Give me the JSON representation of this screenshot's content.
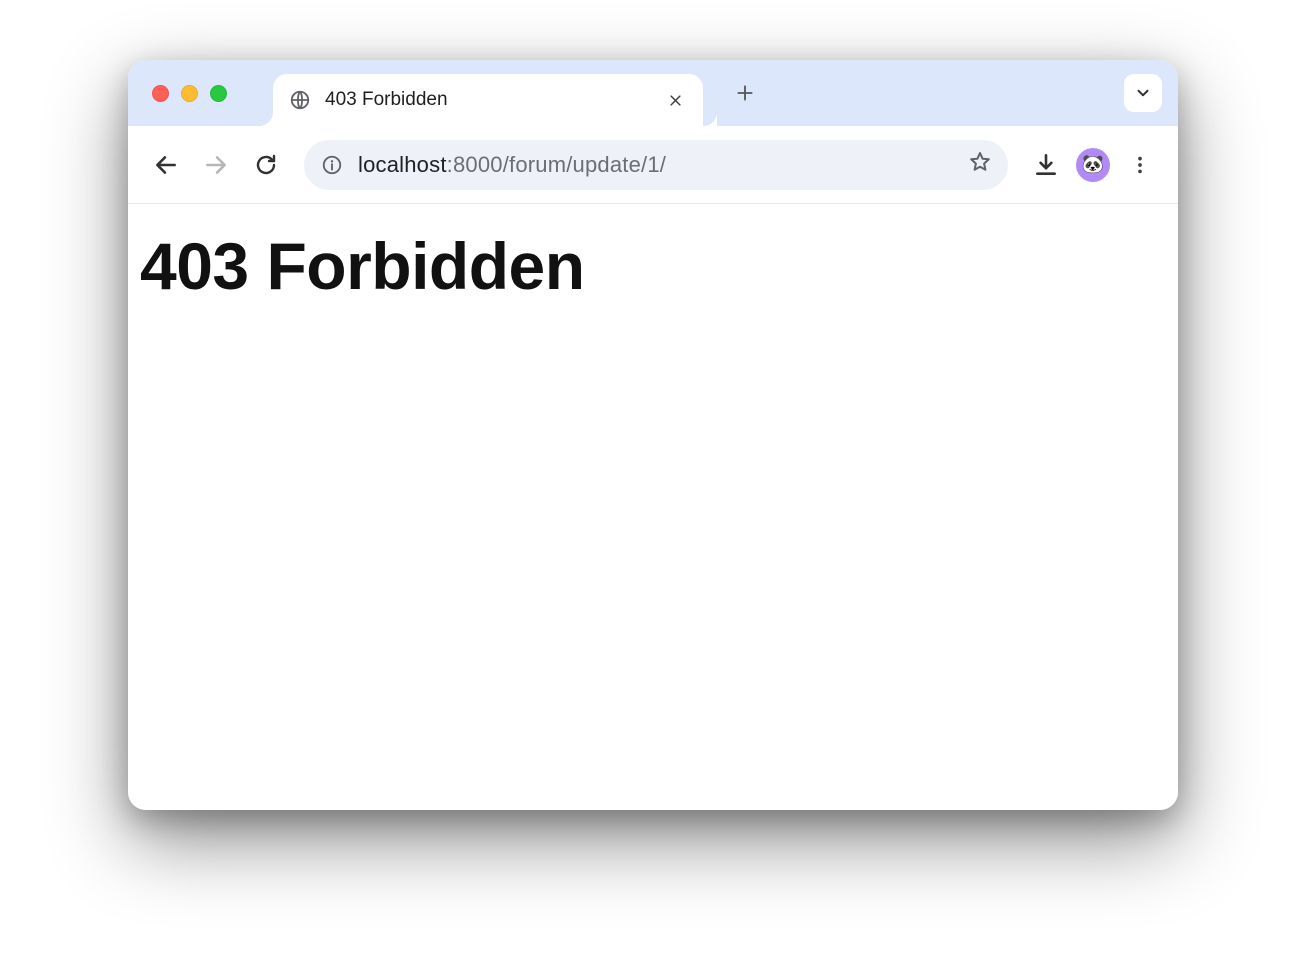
{
  "tab": {
    "title": "403 Forbidden"
  },
  "url": {
    "host": "localhost",
    "port_path": ":8000/forum/update/1/"
  },
  "page": {
    "heading": "403 Forbidden"
  },
  "avatar": {
    "emoji": "🐼"
  }
}
